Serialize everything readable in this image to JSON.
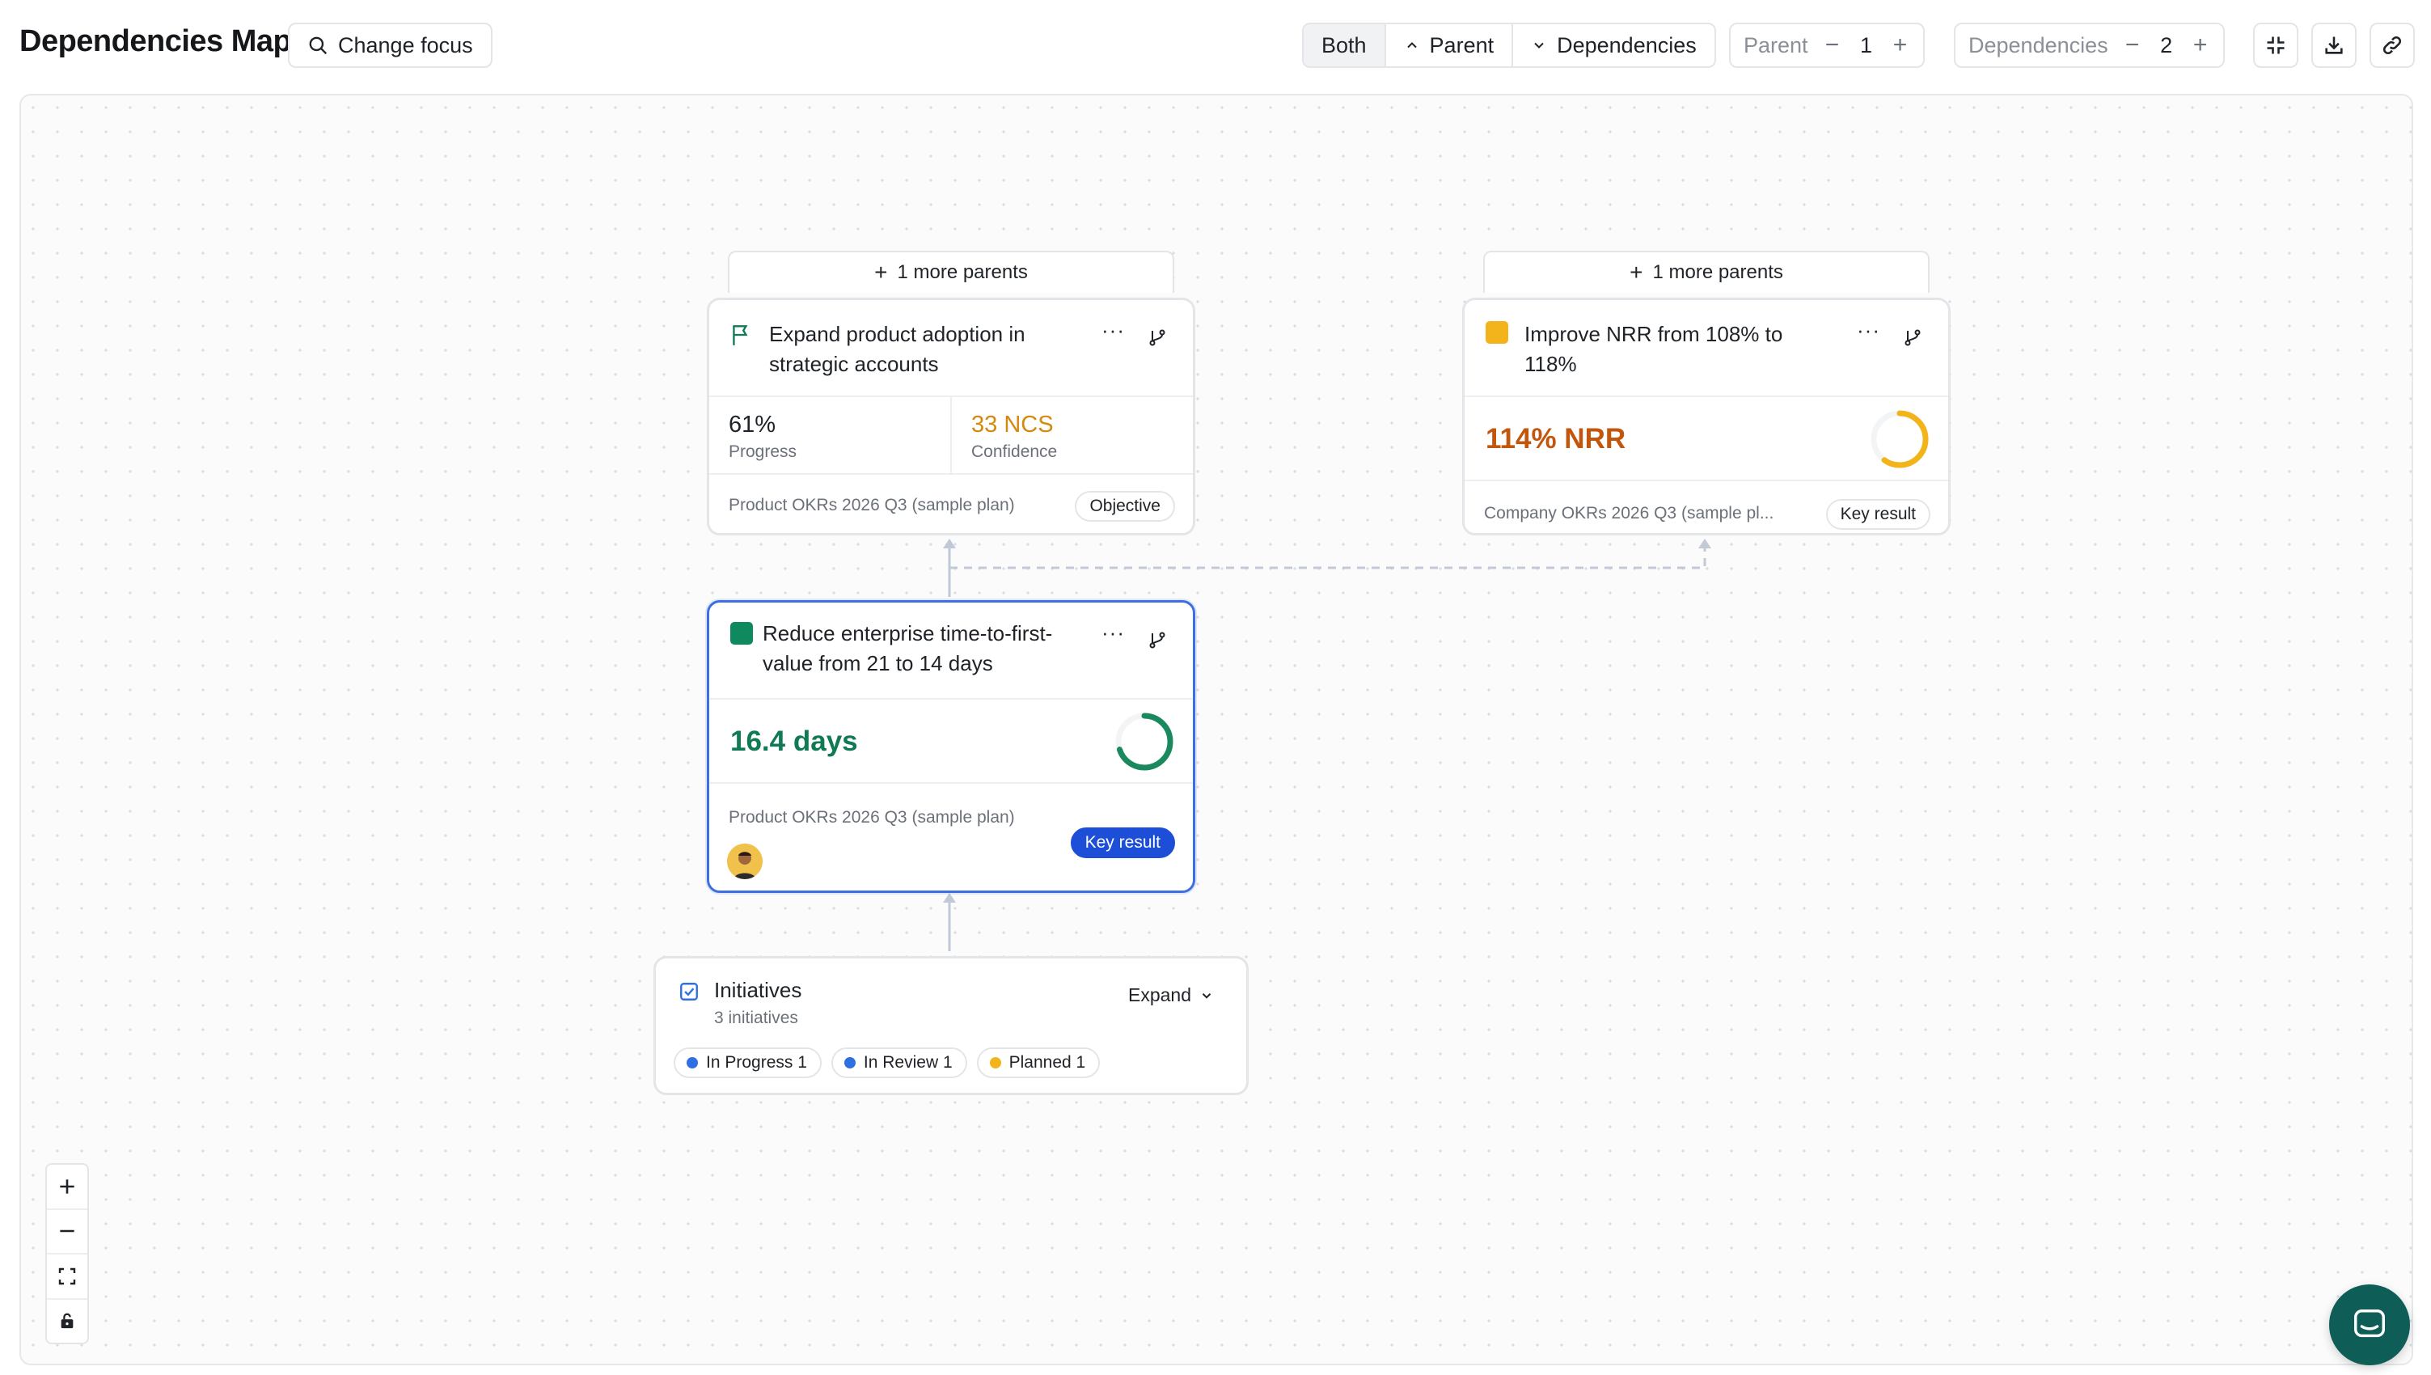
{
  "header": {
    "title": "Dependencies Map",
    "change_focus": "Change focus",
    "direction_tabs": [
      {
        "label": "Both",
        "active": true
      },
      {
        "label": "Parent",
        "active": false
      },
      {
        "label": "Dependencies",
        "active": false
      }
    ],
    "parent_depth": {
      "label": "Parent",
      "value": "1"
    },
    "dependencies_depth": {
      "label": "Dependencies",
      "value": "2"
    }
  },
  "nodes": {
    "objective": {
      "more_parents": "1 more parents",
      "title": "Expand product adoption in strategic accounts",
      "progress_value": "61%",
      "progress_label": "Progress",
      "confidence_value": "33 NCS",
      "confidence_label": "Confidence",
      "plan": "Product OKRs 2026 Q3 (sample plan)",
      "type_badge": "Objective",
      "confidence_color": "#d4890f"
    },
    "nrr": {
      "more_parents": "1 more parents",
      "title": "Improve NRR from 108% to 118%",
      "value": "114% NRR",
      "value_color": "#c2560c",
      "ring_progress": 0.6,
      "ring_color": "#f2b31b",
      "plan": "Company OKRs 2026 Q3 (sample pl...",
      "type_badge": "Key result"
    },
    "focus": {
      "title": "Reduce enterprise time-to-first-value from 21 to 14 days",
      "value": "16.4 days",
      "value_color": "#0f7a54",
      "ring_progress": 0.7,
      "ring_color": "#1a8a5e",
      "plan": "Product OKRs 2026 Q3 (sample plan)",
      "type_badge": "Key result"
    },
    "initiatives": {
      "title": "Initiatives",
      "subtitle": "3 initiatives",
      "expand": "Expand",
      "statuses": [
        {
          "label": "In Progress 1",
          "color": "#2f6fe4"
        },
        {
          "label": "In Review 1",
          "color": "#2f6fe4"
        },
        {
          "label": "Planned 1",
          "color": "#f2b31b"
        }
      ]
    }
  },
  "icons": {
    "search": "search-icon",
    "flag": "flag-icon",
    "branch": "branch-icon",
    "more": "more-icon",
    "plus": "plus-icon",
    "minus": "minus-icon",
    "fit": "fit-view-icon",
    "lock": "lock-icon",
    "download": "download-icon",
    "link": "link-icon",
    "collapse": "collapse-icon",
    "chat": "chat-icon"
  }
}
